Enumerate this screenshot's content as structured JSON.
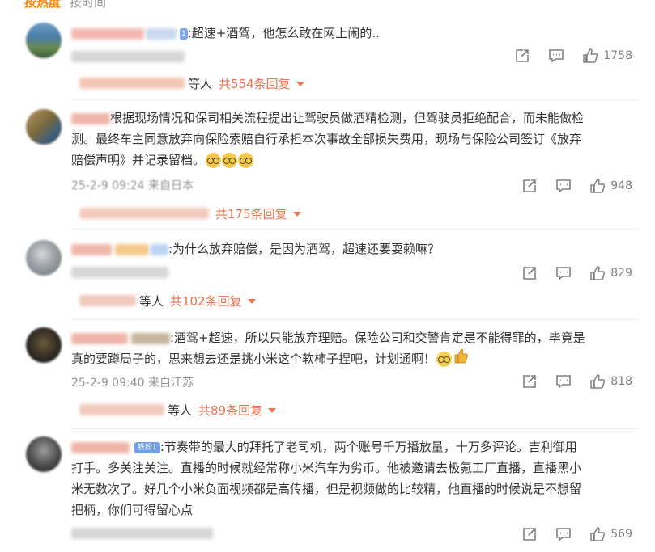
{
  "header": {
    "tab_hot": "按热度",
    "tab_time": "按时间"
  },
  "comments": [
    {
      "text": ":超速+酒驾，他怎么敢在网上闹的..",
      "badge": "1",
      "likes": "1758",
      "replies": {
        "who": "等人",
        "count": "共554条回复"
      }
    },
    {
      "lines": [
        "根据现场情况和保司相关流程提出让驾驶员做酒精检测，但驾驶员拒绝配合，而未能做检",
        "测。最终车主同意放弃向保险索赔自行承担本次事故全部损失费用，现场与保险公司签订《放弃",
        "赔偿声明》并记录留档。"
      ],
      "meta": "25-2-9 09:24 来自日本",
      "likes": "948",
      "replies": {
        "count": "共175条回复"
      }
    },
    {
      "text": ":为什么放弃赔偿，是因为酒驾，超速还要耍赖嘛？",
      "likes": "829",
      "replies": {
        "who": "等人",
        "count": "共102条回复"
      }
    },
    {
      "lines": [
        ":酒驾+超速，所以只能放弃理赔。保险公司和交警肯定是不能得罪的，毕竟是",
        "真的要蹲局子的，思来想去还是挑小米这个软柿子捏吧，计划通啊！"
      ],
      "meta": "25-2-9 09:40 来自江苏",
      "likes": "818",
      "replies": {
        "who": "等人",
        "count": "共89条回复"
      }
    },
    {
      "badge": "铁粉1",
      "lines": [
        ":节奏带的最大的拜托了老司机，两个账号千万播放量，十万多评论。吉利御用",
        "打手。多关注关注。直播的时候就经常称小米汽车为劣币。他被邀请去极氪工厂直播，直播黑小",
        "米无数次了。好几个小米负面视频都是高传播，但是视频做的比较精，他直播的时候说是不想留",
        "把柄，你们可得留心点"
      ],
      "likes": "569"
    }
  ],
  "icons": {
    "share": "share-icon",
    "comment": "comment-icon",
    "like": "thumbs-up-icon"
  },
  "colors": {
    "accent": "#ff8200",
    "reply_link": "#eb7350",
    "meta": "#939393"
  }
}
